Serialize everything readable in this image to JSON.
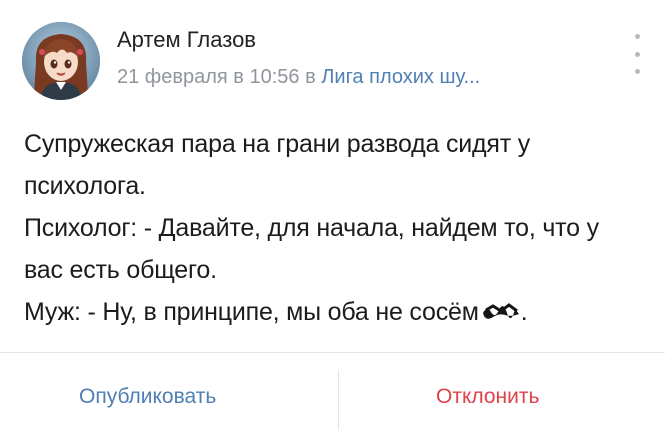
{
  "header": {
    "author": "Артем Глазов",
    "date": "21 февраля в 10:56 в ",
    "group": "Лига плохих шу...",
    "avatar_icon": "anime-girl-avatar-icon",
    "more_icon": "vertical-dots-icon"
  },
  "post": {
    "lines": [
      "Супружеская пара на грани развода сидят у психолога.",
      "Психолог: - Давайте, для начала, найдем то, что у вас есть общего.",
      "Муж: - Ну, в принципе, мы оба не сосём"
    ],
    "end_punct": ".",
    "censored_icon": "scribble-censor-icon"
  },
  "actions": {
    "publish_label": "Опубликовать",
    "reject_label": "Отклонить"
  },
  "colors": {
    "link": "#4f7fb4",
    "reject": "#e0414a",
    "meta": "#8f959d"
  }
}
